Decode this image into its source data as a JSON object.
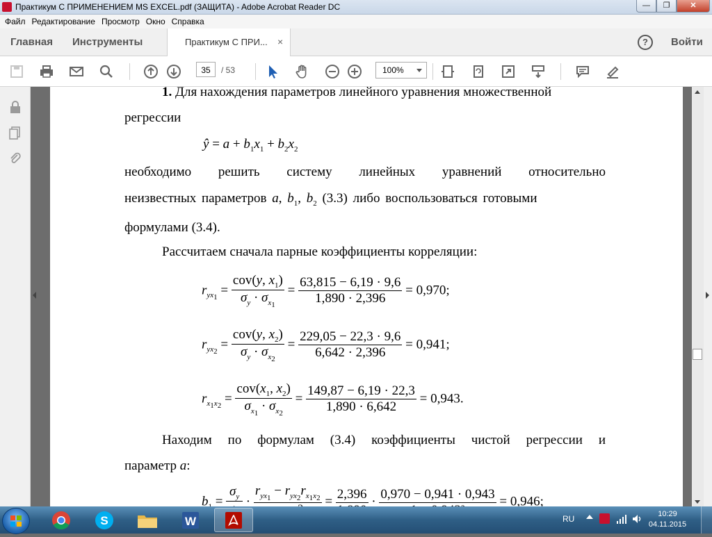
{
  "window": {
    "title": "Практикум С ПРИМЕНЕНИЕМ MS EXCEL.pdf (ЗАЩИТА) - Adobe Acrobat Reader DC",
    "minimize": "—",
    "maximize": "❐",
    "close": "✕"
  },
  "menu": [
    "Файл",
    "Редактирование",
    "Просмотр",
    "Окно",
    "Справка"
  ],
  "tabs": {
    "home": "Главная",
    "tools": "Инструменты",
    "document": "Практикум С ПРИ...",
    "close": "×",
    "help": "?",
    "signin": "Войти"
  },
  "toolbar": {
    "page_current": "35",
    "page_total": "/ 53",
    "zoom": "100%"
  },
  "document": {
    "p1_bold": "1.",
    "p1_line1": " Для нахождения параметров линейного уравнения множественной",
    "p1_line2": "регрессии",
    "p2_line1": "необходимо решить систему линейных уравнений относительно",
    "p2_line2_a": "неизвестных параметров",
    "p2_line2_b": "(3.3) либо воспользоваться готовыми",
    "p2_line3": "формулами (3.4).",
    "p3": "Рассчитаем сначала парные коэффициенты корреляции:",
    "p4_line1": "Находим по формулам (3.4) коэффициенты чистой регрессии и",
    "p4_line2": "параметр",
    "formulas": {
      "r1_num2": "63,815 − 6,19 · 9,6",
      "r1_den2": "1,890 · 2,396",
      "r1_result": "= 0,970",
      "r2_num2": "229,05 − 22,3 · 9,6",
      "r2_den2": "6,642 · 2,396",
      "r2_result": "= 0,941",
      "r3_num2": "149,87 − 6,19 · 22,3",
      "r3_den2": "1,890 · 6,642",
      "r3_result": "= 0,943",
      "b_frac": "2,396",
      "b_num": "0,970 − 0,941 · 0,943",
      "b_result": "= 0,946"
    }
  },
  "taskbar": {
    "lang": "RU",
    "time": "10:29",
    "date": "04.11.2015"
  }
}
